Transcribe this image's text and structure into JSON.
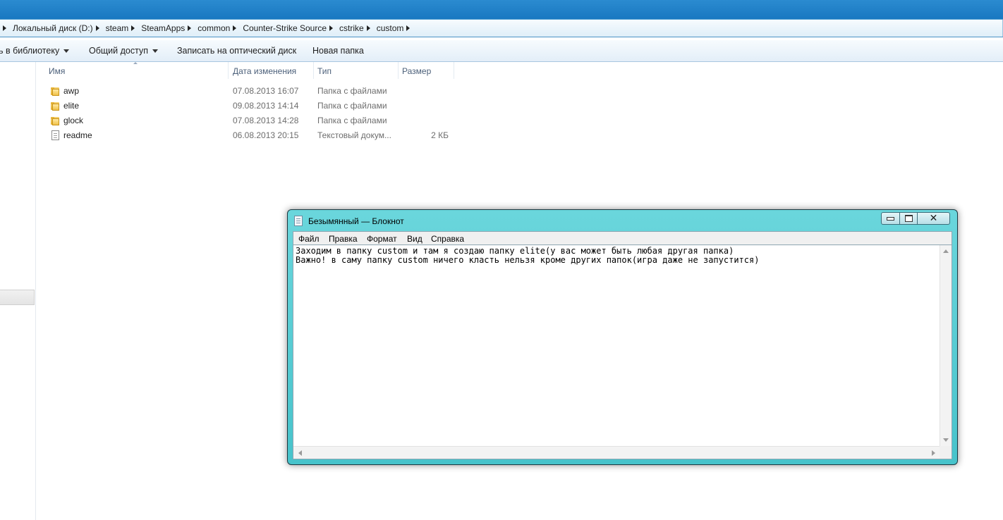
{
  "explorer": {
    "breadcrumbs": [
      "Локальный диск (D:)",
      "steam",
      "SteamApps",
      "common",
      "Counter-Strike Source",
      "cstrike",
      "custom"
    ],
    "toolbar": {
      "include_library": "ь в библиотеку",
      "share": "Общий доступ",
      "burn": "Записать на оптический диск",
      "new_folder": "Новая папка"
    },
    "columns": {
      "name": "Имя",
      "date": "Дата изменения",
      "type": "Тип",
      "size": "Размер"
    },
    "files": [
      {
        "name": "awp",
        "date": "07.08.2013 16:07",
        "type": "Папка с файлами",
        "size": "",
        "icon": "folder-icon"
      },
      {
        "name": "elite",
        "date": "09.08.2013 14:14",
        "type": "Папка с файлами",
        "size": "",
        "icon": "folder-icon"
      },
      {
        "name": "glock",
        "date": "07.08.2013 14:28",
        "type": "Папка с файлами",
        "size": "",
        "icon": "folder-icon"
      },
      {
        "name": "readme",
        "date": "06.08.2013 20:15",
        "type": "Текстовый докум...",
        "size": "2 КБ",
        "icon": "text-file-icon"
      }
    ]
  },
  "notepad": {
    "title": "Безымянный — Блокнот",
    "menu": [
      "Файл",
      "Правка",
      "Формат",
      "Вид",
      "Справка"
    ],
    "lines": [
      "Заходим в папку custom и там я создаю папку elite(у вас может быть любая другая папка)",
      "Важно! в саму папку custom ничего класть нельзя кроме других папок(игра даже не запустится)"
    ],
    "close_glyph": "✕"
  }
}
